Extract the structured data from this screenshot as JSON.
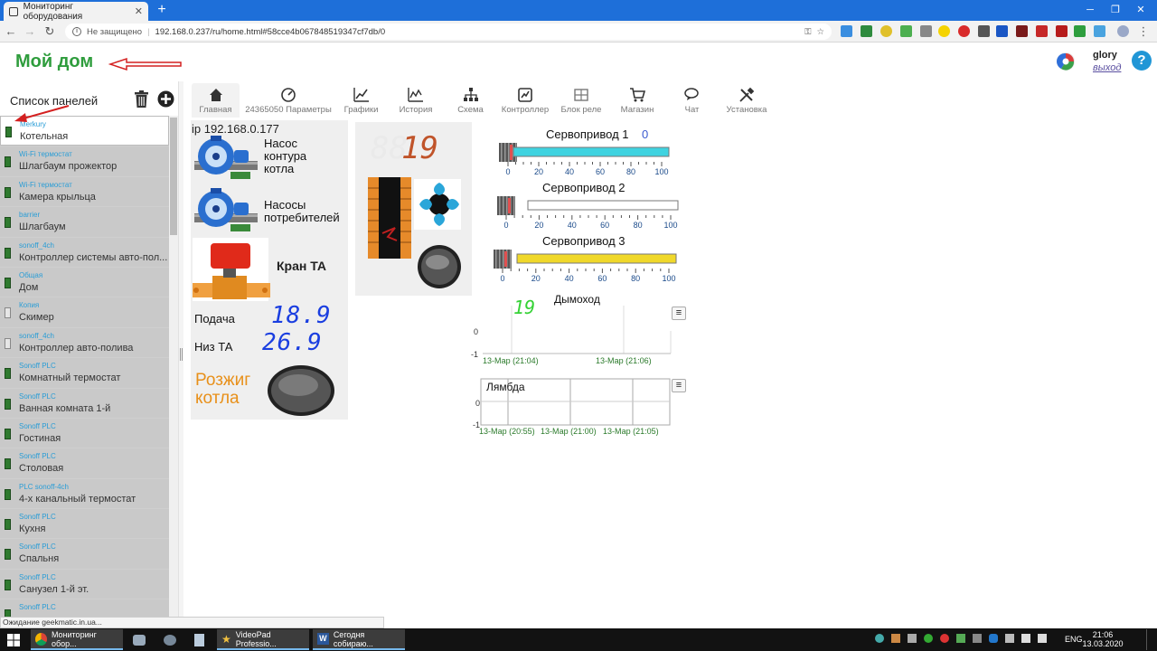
{
  "browser": {
    "tab_title": "Мониторинг оборудования",
    "not_secure": "Не защищено",
    "url": "192.168.0.237/ru/home.html#58cce4b067848519347cf7db/0"
  },
  "header": {
    "logo": "Мой дом",
    "user": "glory",
    "logout": "выход",
    "help": "?"
  },
  "sidebar": {
    "title": "Список панелей",
    "items": [
      {
        "type": "Merkury",
        "name": "Котельная",
        "selected": true,
        "icon": "green"
      },
      {
        "type": "Wi-Fi термостат",
        "name": "Шлагбаум прожектор",
        "icon": "green"
      },
      {
        "type": "Wi-Fi термостат",
        "name": "Камера крыльца",
        "icon": "green"
      },
      {
        "type": "barrier",
        "name": "Шлагбаум",
        "icon": "green"
      },
      {
        "type": "sonoff_4ch",
        "name": "Контроллер системы авто-пол...",
        "icon": "green"
      },
      {
        "type": "Общая",
        "name": "Дом",
        "icon": "green"
      },
      {
        "type": "Копия",
        "name": "Скимер",
        "icon": "gray"
      },
      {
        "type": "sonoff_4ch",
        "name": "Контроллер авто-полива",
        "icon": "gray"
      },
      {
        "type": "Sonoff PLC",
        "name": "Комнатный термостат",
        "icon": "green"
      },
      {
        "type": "Sonoff PLC",
        "name": "Ванная комната 1-й",
        "icon": "green"
      },
      {
        "type": "Sonoff PLC",
        "name": "Гостиная",
        "icon": "green"
      },
      {
        "type": "Sonoff PLC",
        "name": "Столовая",
        "icon": "green"
      },
      {
        "type": "PLC sonoff-4ch",
        "name": "4-х канальный термостат",
        "icon": "green"
      },
      {
        "type": "Sonoff PLC",
        "name": "Кухня",
        "icon": "green"
      },
      {
        "type": "Sonoff PLC",
        "name": "Спальня",
        "icon": "green"
      },
      {
        "type": "Sonoff PLC",
        "name": "Санузел 1-й эт.",
        "icon": "green"
      },
      {
        "type": "Sonoff PLC",
        "name": "",
        "icon": "green"
      }
    ]
  },
  "tabs": [
    "Главная",
    "24365050 Параметры",
    "Графики",
    "История",
    "Схема",
    "Контроллер",
    "Блок реле",
    "Магазин",
    "Чат",
    "Установка"
  ],
  "panel": {
    "ip": "ip 192.168.0.177",
    "pump1": [
      "Насос",
      "контура",
      "котла"
    ],
    "pump2": [
      "Насосы",
      "потребителей"
    ],
    "valve": "Кран ТА",
    "supply_label": "Подача",
    "supply_value": "18.9",
    "bottom_label": "Низ ТА",
    "bottom_value": "26.9",
    "ignite": [
      "Розжиг",
      "котла"
    ],
    "stove_value": "19"
  },
  "servos": [
    {
      "title": "Сервопривод 1",
      "value": "0",
      "fill": 1.0,
      "color": "#3fd3e0"
    },
    {
      "title": "Сервопривод 2",
      "value": "",
      "fill": 0.0,
      "color": "#ffffff"
    },
    {
      "title": "Сервопривод 3",
      "value": "",
      "fill": 1.0,
      "color": "#f0d82a"
    }
  ],
  "servo_ticks": [
    "0",
    "20",
    "40",
    "60",
    "80",
    "100"
  ],
  "charts": [
    {
      "title": "Дымоход",
      "value": "19",
      "y_ticks": [
        "0",
        "-1"
      ],
      "x_ticks": [
        "13-Мар (21:04)",
        "13-Мар (21:06)"
      ]
    },
    {
      "title": "Лямбда",
      "y_ticks": [
        "0",
        "-1"
      ],
      "x_ticks": [
        "13-Мар (20:55)",
        "13-Мар (21:00)",
        "13-Мар (21:05)"
      ]
    }
  ],
  "status_text": "Ожидание geekmatic.in.ua...",
  "taskbar": {
    "items": [
      "Мониторинг обор...",
      "VideoPad Professio...",
      "Сегодня собираю..."
    ],
    "lang": "ENG",
    "time": "21:06",
    "date": "13.03.2020"
  }
}
